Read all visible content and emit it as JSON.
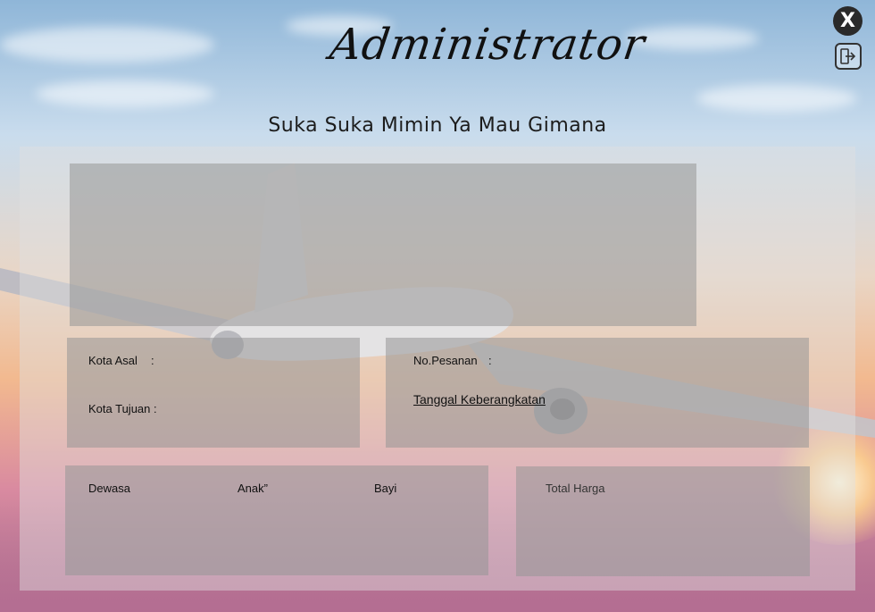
{
  "header": {
    "title": "Administrator",
    "subtitle": "Suka Suka Mimin Ya Mau Gimana"
  },
  "controls": {
    "close_label": "X"
  },
  "route": {
    "origin_label": "Kota Asal",
    "origin_sep": ":",
    "destination_label": "Kota Tujuan :"
  },
  "order": {
    "order_no_label": "No.Pesanan",
    "order_no_sep": ":",
    "departure_date_link": "Tanggal Keberangkatan"
  },
  "passengers": {
    "adult_label": "Dewasa",
    "child_label": "Anak”",
    "infant_label": "Bayi"
  },
  "total": {
    "total_price_label": "Total Harga"
  },
  "icons": {
    "close": "close-icon",
    "logout": "logout-icon"
  },
  "colors": {
    "panel": "#e1e1e1",
    "box": "#969696",
    "close_bg": "#2a2a2a"
  }
}
